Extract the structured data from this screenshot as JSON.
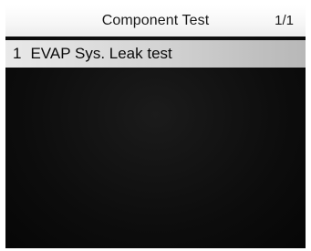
{
  "header": {
    "title": "Component Test",
    "page_indicator": "1/1"
  },
  "menu": {
    "items": [
      {
        "index": "1",
        "label": "EVAP Sys. Leak test",
        "selected": true
      }
    ]
  },
  "colors": {
    "screen_background": "#0d0d0d",
    "title_bar": "#f4f4f4",
    "selection_highlight": "#cfcfcf",
    "text": "#1a1a1a"
  }
}
